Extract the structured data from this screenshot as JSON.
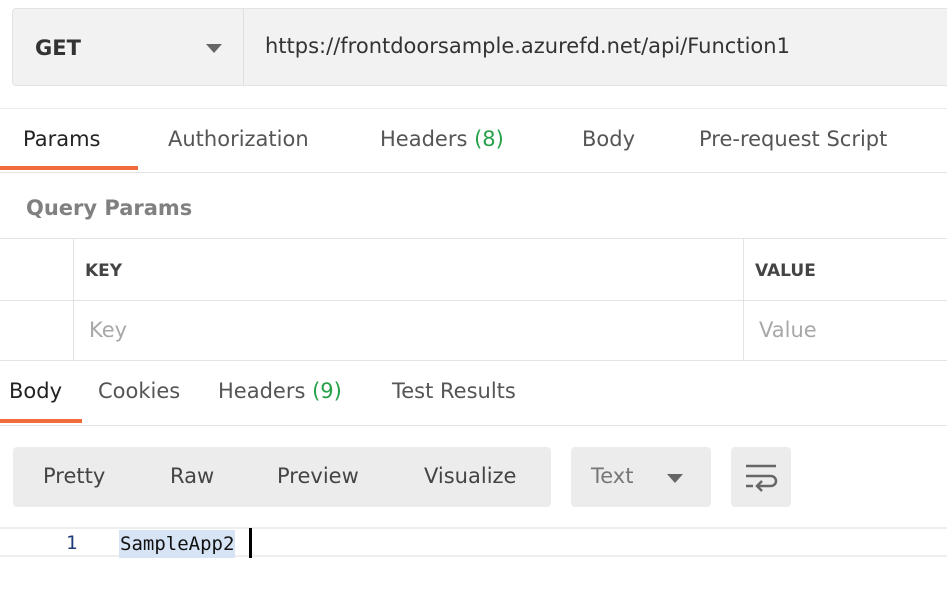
{
  "request": {
    "method": "GET",
    "url": "https://frontdoorsample.azurefd.net/api/Function1"
  },
  "request_tabs": {
    "params": "Params",
    "authorization": "Authorization",
    "headers": "Headers",
    "headers_count": "(8)",
    "body": "Body",
    "prerequest": "Pre-request Script"
  },
  "query_params": {
    "title": "Query Params",
    "key_header": "KEY",
    "value_header": "VALUE",
    "key_placeholder": "Key",
    "value_placeholder": "Value"
  },
  "response_tabs": {
    "body": "Body",
    "cookies": "Cookies",
    "headers": "Headers",
    "headers_count": "(9)",
    "test_results": "Test Results"
  },
  "response_toolbar": {
    "pretty": "Pretty",
    "raw": "Raw",
    "preview": "Preview",
    "visualize": "Visualize",
    "type": "Text"
  },
  "response_body": {
    "line_number": "1",
    "text": "SampleApp2"
  },
  "colors": {
    "accent": "#f26b3a",
    "count_green": "#26a14a"
  }
}
